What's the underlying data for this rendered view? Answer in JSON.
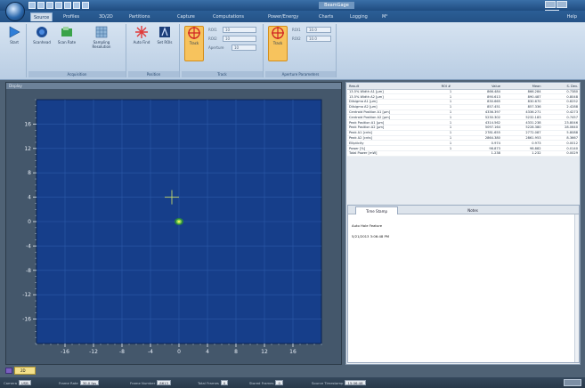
{
  "window": {
    "title": "BeamGage"
  },
  "tabs": [
    {
      "label": "Source",
      "active": true
    },
    {
      "label": "Profiles"
    },
    {
      "label": "3D/2D"
    },
    {
      "label": "Partitions"
    },
    {
      "label": "Capture"
    },
    {
      "label": "Computations"
    },
    {
      "label": "Power/Energy"
    },
    {
      "label": "Charts"
    },
    {
      "label": "Logging"
    },
    {
      "label": "M²"
    }
  ],
  "help_label": "Help",
  "ribbon": {
    "start_label": "Start",
    "scan_group": {
      "buttons": [
        "Scanhead",
        "Scan Rate",
        "Sampling Resolution"
      ],
      "label": "Acquisition"
    },
    "autofind_group": {
      "buttons": [
        "Auto Find",
        "Set ROIs"
      ],
      "label": "Position"
    },
    "track_group_1": {
      "button": "Track",
      "fields": [
        "ROI1",
        "ROI2",
        "Aperture"
      ],
      "values": [
        "10",
        "10",
        "10"
      ],
      "label": "Track"
    },
    "track_group_2": {
      "button": "Track",
      "fields": [
        "ROI1",
        "ROI2"
      ],
      "values": [
        "10.0",
        "10.0"
      ],
      "label": "Aperture Parameters"
    }
  },
  "left_panel": {
    "title": "Display"
  },
  "chart_data": {
    "type": "scatter",
    "title": "",
    "xlabel": "",
    "ylabel": "",
    "xlim": [
      -20,
      20
    ],
    "ylim": [
      -20,
      20
    ],
    "x_ticks": [
      "-16",
      "-12",
      "-8",
      "-4",
      "0",
      "4",
      "8",
      "12",
      "16"
    ],
    "y_ticks": [
      "16",
      "12",
      "8",
      "4",
      "0",
      "-4",
      "-8",
      "-12",
      "-16"
    ],
    "grid": true,
    "background": "#163e8a",
    "crosshair": {
      "x": -1,
      "y": 4
    },
    "beam": {
      "x": 0,
      "y": 0
    }
  },
  "results": {
    "headers": [
      "Result",
      "ROI #",
      "Value",
      "Mean",
      "S. Dev."
    ],
    "rows": [
      [
        "13.5% Width A1 [µm]",
        "1",
        "866.484",
        "866.284",
        "0.7380"
      ],
      [
        "13.5% Width A2 [µm]",
        "1",
        "890.613",
        "890.487",
        "0.8048"
      ],
      [
        "D4sigma A1 [µm]",
        "1",
        "830.665",
        "830.670",
        "0.8252"
      ],
      [
        "D4sigma A2 [µm]",
        "1",
        "857.451",
        "857.336",
        "2.4288"
      ],
      [
        "Centroid Position A1 [µm]",
        "1",
        "4336.397",
        "4336.271",
        "0.4273"
      ],
      [
        "Centroid Position A2 [µm]",
        "1",
        "5230.302",
        "5232.183",
        "0.7457"
      ],
      [
        "Peak Position A1 [µm]",
        "1",
        "4314.562",
        "4331.238",
        "23.8046"
      ],
      [
        "Peak Position A2 [µm]",
        "1",
        "5097.164",
        "5228.380",
        "28.0640"
      ],
      [
        "Peak A1 [cnts]",
        "1",
        "2781.655",
        "2772.087",
        "5.8088"
      ],
      [
        "Peak A2 [cnts]",
        "1",
        "2864.380",
        "2861.953",
        "8.3667"
      ],
      [
        "Ellipticity",
        "1",
        "0.974",
        "0.973",
        "0.0012"
      ],
      [
        "Power [%]",
        "1",
        "98.873",
        "98.882",
        "0.0140"
      ],
      [
        "Total Power [mW]",
        "",
        "1.238",
        "1.232",
        "0.0029"
      ]
    ]
  },
  "notes": {
    "tabs": [
      "Time Stamp",
      "Notes"
    ],
    "lines": [
      "Auto Hole Feature",
      "5/21/2013 3:06:48 PM"
    ]
  },
  "doc_tab": {
    "label": "2D"
  },
  "status": [
    {
      "label": "Camera",
      "value": "USB"
    },
    {
      "label": "Frame Rate",
      "value": "30.0 fps"
    },
    {
      "label": "Frame Number",
      "value": "8613"
    },
    {
      "label": "Total Frames",
      "value": "0"
    },
    {
      "label": "Stored Frames",
      "value": "0"
    },
    {
      "label": "Source Timestamp",
      "value": "15:06:48"
    }
  ]
}
